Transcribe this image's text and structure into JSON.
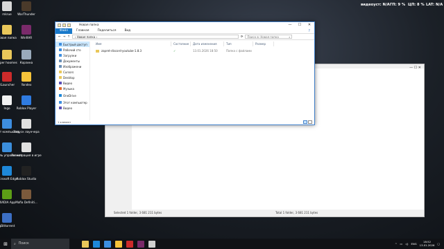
{
  "desktop": {
    "icons": [
      {
        "label": "mkrue",
        "color": "#d8d8d8"
      },
      {
        "label": "WarThunder",
        "color": "#4a3a2a"
      },
      {
        "label": "Новая папка",
        "color": "#e9c75a"
      },
      {
        "label": "WinRAR",
        "color": "#7a2a6a"
      },
      {
        "label": "super hoomes",
        "color": "#e9c75a"
      },
      {
        "label": "Корзина",
        "color": "#9aaabb"
      },
      {
        "label": "KLauncher",
        "color": "#cc2b2b"
      },
      {
        "label": "Yandex",
        "color": "#f6c33a"
      },
      {
        "label": "Ingo",
        "color": "#f2f2f2"
      },
      {
        "label": "Roblox Player",
        "color": "#2f7be0"
      },
      {
        "label": "Этот компьютер",
        "color": "#3d8ee0"
      },
      {
        "label": "Запуск лаунчера",
        "color": "#e0e0e0"
      },
      {
        "label": "Панель управления",
        "color": "#3b8edb"
      },
      {
        "label": "Регистрация в игре",
        "color": "#e0e0e0"
      },
      {
        "label": "Microsoft Edge",
        "color": "#1e88d9"
      },
      {
        "label": "Roblox Studio",
        "color": "#222"
      },
      {
        "label": "NVIDIA App",
        "color": "#5c9e16"
      },
      {
        "label": "Mafia Definiti...",
        "color": "#7b5a3c"
      },
      {
        "label": "qBittorrent",
        "color": "#3c6fc4"
      }
    ],
    "widgets": {
      "cpu_label": "видеоуст: N/A",
      "gpu_temp": "ГП: 9 %",
      "cpu_usage": "ЦП: 8 %",
      "lat": "LAT: N/A"
    }
  },
  "bg_window": {
    "controls": "—  ☐  ✕",
    "status_left": "Selected 1 folder, 3 681 211 bytes",
    "status_right": "Total 1 folder, 3 681 211 bytes"
  },
  "explorer": {
    "title": "Новая папка",
    "window_buttons": [
      "—",
      "☐",
      "✕"
    ],
    "ribbon": [
      "Файл",
      "Главная",
      "Поделиться",
      "Вид"
    ],
    "nav": {
      "back": "←",
      "forward": "→",
      "up": "↑"
    },
    "address": "›  Новая папка  ›",
    "search_placeholder": "Поиск в: Новая папка",
    "sidebar": [
      {
        "label": "Быстрый доступ",
        "color": "#3d8ee0",
        "selected": true
      },
      {
        "label": "Рабочий сто",
        "color": "#3d8ee0"
      },
      {
        "label": "Загрузки",
        "color": "#3d8ee0"
      },
      {
        "label": "Документы",
        "color": "#6a8fb7"
      },
      {
        "label": "Изображени",
        "color": "#6a8fb7"
      },
      {
        "label": "Cursors",
        "color": "#e9c75a"
      },
      {
        "label": "Desktop",
        "color": "#e9c75a"
      },
      {
        "label": "Видео",
        "color": "#5a4fb7"
      },
      {
        "label": "Музыка",
        "color": "#e06a2a"
      },
      {
        "label": "OneDrive",
        "color": "#1e88d9"
      },
      {
        "label": "Этот компьютер",
        "color": "#3d8ee0"
      },
      {
        "label": "Видео",
        "color": "#5a4fb7"
      }
    ],
    "columns": [
      "Имя",
      "Состояние",
      "Дата изменения",
      "Тип",
      "Размер"
    ],
    "rows": [
      {
        "name": "zapret-discord-youtube-1.8.3",
        "state": "✓",
        "date": "13.01.2026 18:50",
        "type": "Папка с файлами",
        "size": ""
      }
    ],
    "status": "1 элемент"
  },
  "taskbar": {
    "search_label": "Поиск",
    "tray_lang": "ENG",
    "time": "18:52",
    "date": "13.01.2026"
  }
}
